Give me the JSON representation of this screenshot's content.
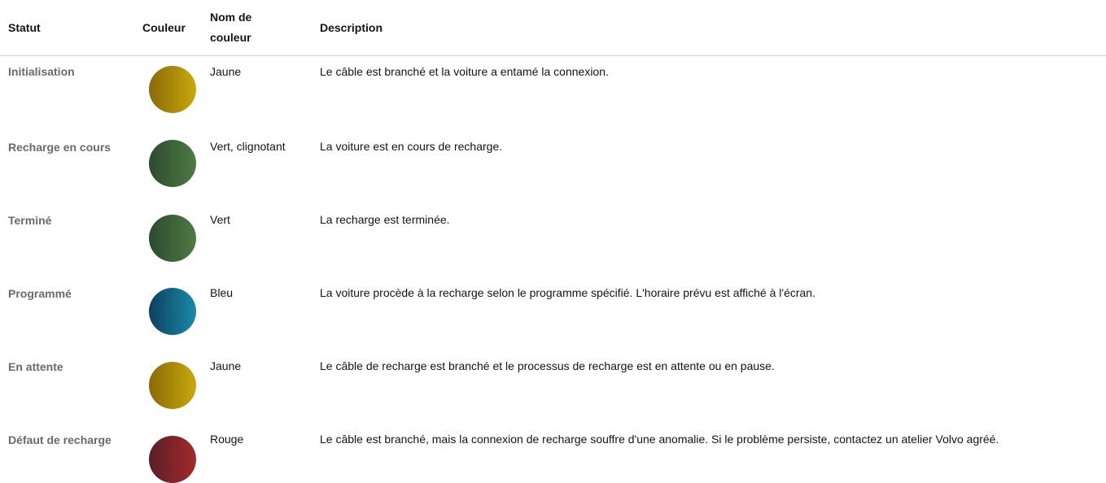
{
  "header": {
    "statut": "Statut",
    "couleur": "Couleur",
    "nom_couleur_line1": "Nom de",
    "nom_couleur_line2": "couleur",
    "description": "Description"
  },
  "rows": [
    {
      "statut": "Initialisation",
      "couleur_name": "Jaune",
      "description": "Le câble est branché et la voiture a entamé la connexion.",
      "color_dark": "#8a6a08",
      "color_light": "#c9a80a"
    },
    {
      "statut": "Recharge en cours",
      "couleur_name": "Vert, clignotant",
      "description": "La voiture est en cours de recharge.",
      "color_dark": "#2c4a30",
      "color_light": "#4f7a42"
    },
    {
      "statut": "Terminé",
      "couleur_name": "Vert",
      "description": "La recharge est terminée.",
      "color_dark": "#2c4a30",
      "color_light": "#4f7a42"
    },
    {
      "statut": "Programmé",
      "couleur_name": "Bleu",
      "description": "La voiture procède à la recharge selon le programme spécifié. L'horaire prévu est affiché à l'écran.",
      "color_dark": "#0d4060",
      "color_light": "#1a8aa8"
    },
    {
      "statut": "En attente",
      "couleur_name": "Jaune",
      "description": "Le câble de recharge est branché et le processus de recharge est en attente ou en pause.",
      "color_dark": "#8a6a08",
      "color_light": "#c9a80a"
    },
    {
      "statut": "Défaut de recharge",
      "couleur_name": "Rouge",
      "description": "Le câble est branché, mais la connexion de recharge souffre d'une anomalie. Si le problème persiste, contactez un atelier Volvo agréé.",
      "color_dark": "#5a1e28",
      "color_light": "#a32a2a"
    }
  ]
}
